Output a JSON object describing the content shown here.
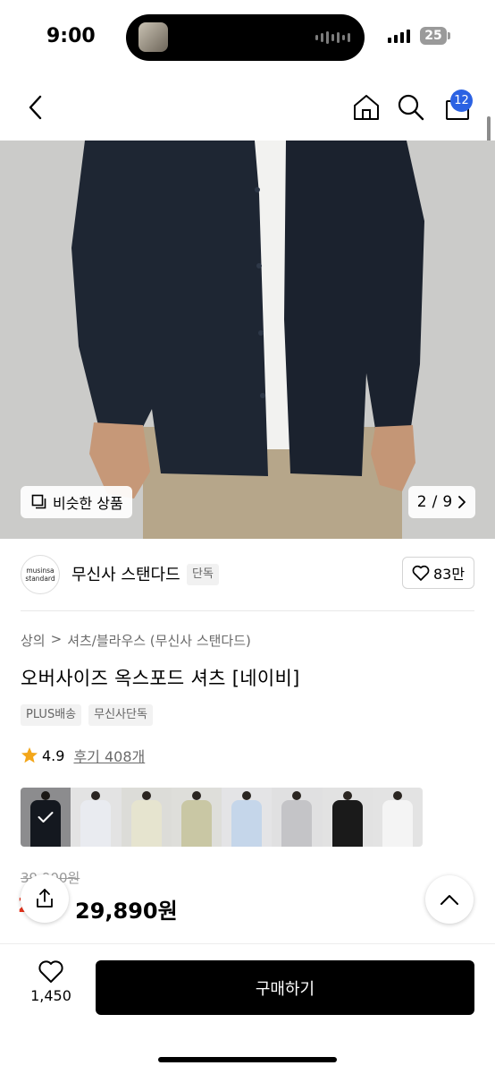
{
  "status_bar": {
    "time": "9:00",
    "battery": "25"
  },
  "nav": {
    "cart_count": "12"
  },
  "hero": {
    "similar_label": "비슷한 상품",
    "page_current": "2",
    "page_total": "9",
    "page_separator": "/"
  },
  "brand": {
    "logo_line1": "musinsa",
    "logo_line2": "standard",
    "name": "무신사 스탠다드",
    "exclusive_tag": "단독",
    "like_count": "83만"
  },
  "product": {
    "breadcrumb": [
      "상의",
      ">",
      "셔츠/블라우스 (무신사 스탠다드)"
    ],
    "title": "오버사이즈 옥스포드 셔츠 [네이비]",
    "tags": [
      "PLUS배송",
      "무신사단독"
    ],
    "rating": "4.9",
    "reviews_label": "후기 408개",
    "colors": [
      {
        "name": "navy",
        "color": "#1f2530",
        "selected": true
      },
      {
        "name": "white-stripe",
        "color": "#e9ebf0"
      },
      {
        "name": "cream",
        "color": "#e6e4cf"
      },
      {
        "name": "olive",
        "color": "#c9c7a4"
      },
      {
        "name": "light-blue",
        "color": "#c5d6ea"
      },
      {
        "name": "gray",
        "color": "#c4c4c7"
      },
      {
        "name": "black",
        "color": "#1a1a1a"
      },
      {
        "name": "white",
        "color": "#f4f4f4"
      }
    ],
    "original_price": "39,900원",
    "discount": "25%",
    "sale_price": "29,890원"
  },
  "bottom_bar": {
    "wish_count": "1,450",
    "buy_label": "구매하기"
  }
}
